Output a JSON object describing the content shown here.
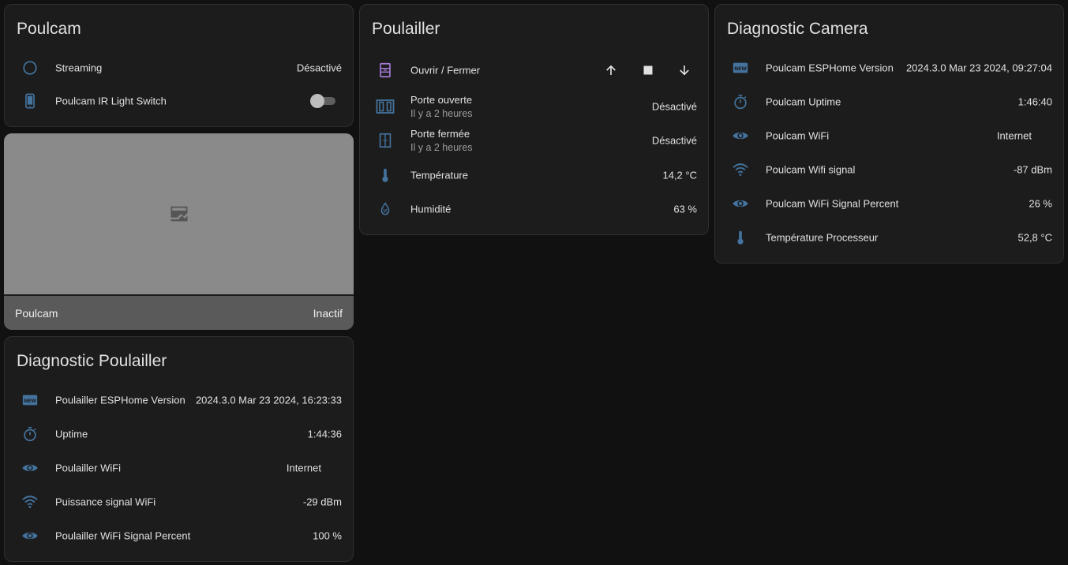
{
  "colors": {
    "icon_blue": "#44739e",
    "icon_purple": "#a77bd8",
    "background": "#111111",
    "card": "#1c1c1c"
  },
  "poulcam": {
    "title": "Poulcam",
    "rows": [
      {
        "icon": "circle-outline-icon",
        "label": "Streaming",
        "value": "Désactivé"
      },
      {
        "icon": "cellphone-icon",
        "label": "Poulcam IR Light Switch",
        "toggle": false
      }
    ]
  },
  "camera": {
    "icon": "image-broken-icon",
    "name": "Poulcam",
    "state": "Inactif"
  },
  "diag_poulailler": {
    "title": "Diagnostic Poulailler",
    "rows": [
      {
        "icon": "new-box-icon",
        "label": "Poulailler ESPHome Version",
        "value": "2024.3.0 Mar 23 2024, 16:23:33"
      },
      {
        "icon": "timer-icon",
        "label": "Uptime",
        "value": "1:44:36"
      },
      {
        "icon": "eye-icon",
        "label": "Poulailler WiFi",
        "value": "Internet"
      },
      {
        "icon": "wifi-icon",
        "label": "Puissance signal WiFi",
        "value": "-29 dBm"
      },
      {
        "icon": "eye-icon",
        "label": "Poulailler WiFi Signal Percent",
        "value": "100 %"
      }
    ]
  },
  "poulailler": {
    "title": "Poulailler",
    "cover": {
      "icon": "door-icon",
      "label": "Ouvrir / Fermer"
    },
    "rows": [
      {
        "icon": "door-open-icon",
        "label": "Porte ouverte",
        "sub": "Il y a 2 heures",
        "value": "Désactivé"
      },
      {
        "icon": "door-closed-icon",
        "label": "Porte fermée",
        "sub": "Il y a 2 heures",
        "value": "Désactivé"
      },
      {
        "icon": "thermometer-icon",
        "label": "Température",
        "value": "14,2 °C"
      },
      {
        "icon": "water-percent-icon",
        "label": "Humidité",
        "value": "63 %"
      }
    ]
  },
  "diag_camera": {
    "title": "Diagnostic Camera",
    "rows": [
      {
        "icon": "new-box-icon",
        "label": "Poulcam ESPHome Version",
        "value": "2024.3.0 Mar 23 2024, 09:27:04"
      },
      {
        "icon": "timer-icon",
        "label": "Poulcam Uptime",
        "value": "1:46:40"
      },
      {
        "icon": "eye-icon",
        "label": "Poulcam WiFi",
        "value": "Internet"
      },
      {
        "icon": "wifi-icon",
        "label": "Poulcam Wifi signal",
        "value": "-87 dBm"
      },
      {
        "icon": "eye-icon",
        "label": "Poulcam WiFi Signal Percent",
        "value": "26 %"
      },
      {
        "icon": "thermometer-icon",
        "label": "Température Processeur",
        "value": "52,8 °C"
      }
    ]
  }
}
